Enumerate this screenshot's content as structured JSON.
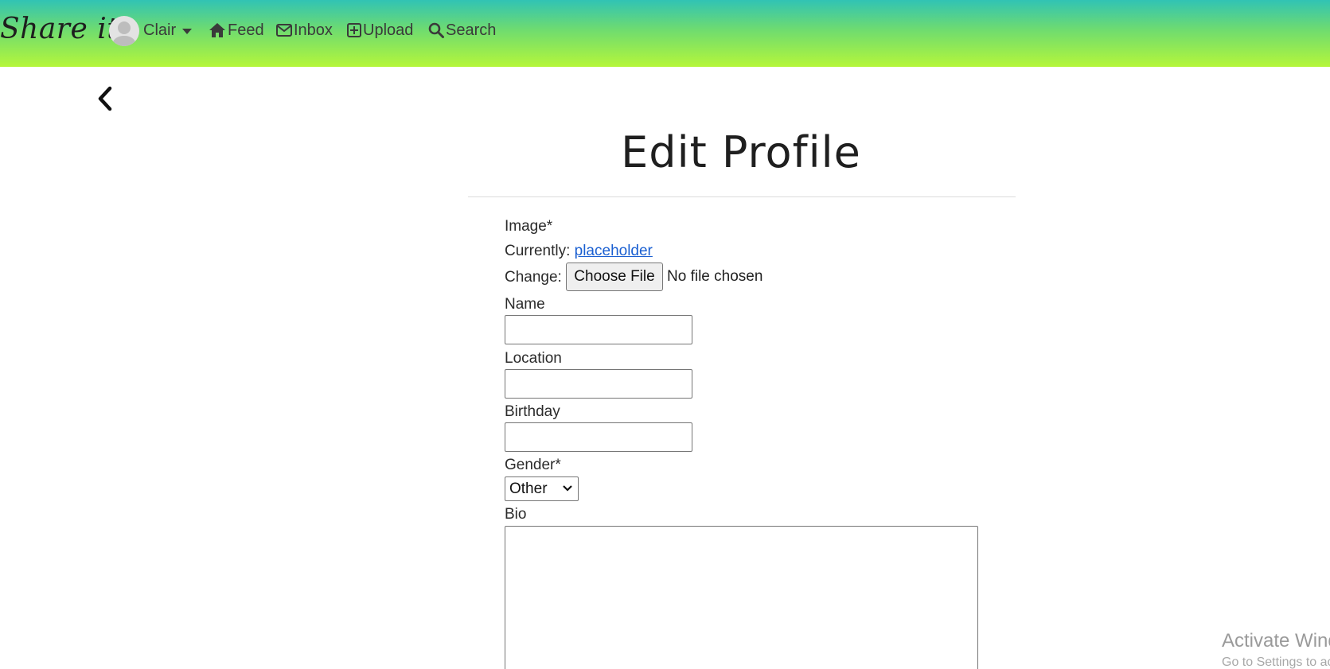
{
  "navbar": {
    "brand": "Share it",
    "user_name": "Clair",
    "items": [
      {
        "label": "Feed",
        "icon": "home-icon"
      },
      {
        "label": "Inbox",
        "icon": "envelope-icon"
      },
      {
        "label": "Upload",
        "icon": "plus-square-icon"
      },
      {
        "label": "Search",
        "icon": "search-icon"
      }
    ],
    "gradient_colors": [
      "#31c3b4",
      "#b5f63a"
    ]
  },
  "back_icon": "chevron-left-icon",
  "page": {
    "title": "Edit Profile"
  },
  "form": {
    "image_label": "Image*",
    "currently_label": "Currently:",
    "currently_link": "placeholder",
    "change_label": "Change:",
    "choose_file_button": "Choose File",
    "file_status": "No file chosen",
    "name_label": "Name",
    "name_value": "",
    "location_label": "Location",
    "location_value": "",
    "birthday_label": "Birthday",
    "birthday_value": "",
    "gender_label": "Gender*",
    "gender_value": "Other",
    "bio_label": "Bio",
    "bio_value": ""
  },
  "watermark": {
    "title": "Activate Windows",
    "subtitle": "Go to Settings to activate Windows."
  }
}
